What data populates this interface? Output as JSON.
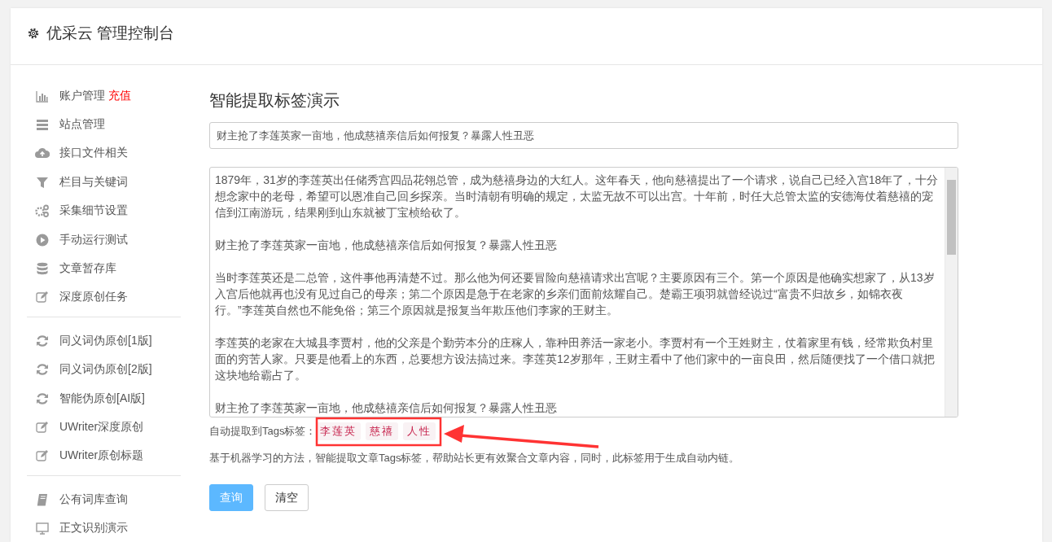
{
  "header": {
    "title": "优采云 管理控制台"
  },
  "sidebar": {
    "groups": [
      [
        {
          "label": "账户管理",
          "badge": "充值"
        },
        {
          "label": "站点管理"
        },
        {
          "label": "接口文件相关"
        },
        {
          "label": "栏目与关键词"
        },
        {
          "label": "采集细节设置"
        },
        {
          "label": "手动运行测试"
        },
        {
          "label": "文章暂存库"
        },
        {
          "label": "深度原创任务"
        }
      ],
      [
        {
          "label": "同义词伪原创[1版]"
        },
        {
          "label": "同义词伪原创[2版]"
        },
        {
          "label": "智能伪原创[AI版]"
        },
        {
          "label": "UWriter深度原创"
        },
        {
          "label": "UWriter原创标题"
        }
      ],
      [
        {
          "label": "公有词库查询"
        },
        {
          "label": "正文识别演示"
        }
      ]
    ]
  },
  "main": {
    "title": "智能提取标签演示",
    "title_field": {
      "value": "财主抢了李莲英家一亩地，他成慈禧亲信后如何报复？暴露人性丑恶"
    },
    "article": [
      "1879年，31岁的李莲英出任储秀宫四品花翎总管，成为慈禧身边的大红人。这年春天，他向慈禧提出了一个请求，说自己已经入宫18年了，十分想念家中的老母，希望可以恩准自己回乡探亲。当时清朝有明确的规定，太监无故不可以出宫。十年前，时任大总管太监的安德海仗着慈禧的宠信到江南游玩，结果刚到山东就被丁宝桢给砍了。",
      "财主抢了李莲英家一亩地，他成慈禧亲信后如何报复？暴露人性丑恶",
      "当时李莲英还是二总管，这件事他再清楚不过。那么他为何还要冒险向慈禧请求出宫呢？主要原因有三个。第一个原因是他确实想家了，从13岁入宫后他就再也没有见过自己的母亲；第二个原因是急于在老家的乡亲们面前炫耀自己。楚霸王项羽就曾经说过“富贵不归故乡，如锦衣夜行。”李莲英自然也不能免俗；第三个原因就是报复当年欺压他们李家的王财主。",
      "李莲英的老家在大城县李贾村，他的父亲是个勤劳本分的庄稼人，靠种田养活一家老小。李贾村有一个王姓财主，仗着家里有钱，经常欺负村里面的穷苦人家。只要是他看上的东西，总要想方设法搞过来。李莲英12岁那年，王财主看中了他们家中的一亩良田，然后随便找了一个借口就把这块地给霸占了。",
      "财主抢了李莲英家一亩地，他成慈禧亲信后如何报复？暴露人性丑恶"
    ],
    "tags_label": "自动提取到Tags标签：",
    "tags": [
      "李莲英",
      "慈禧",
      "人性"
    ],
    "description": "基于机器学习的方法，智能提取文章Tags标签，帮助站长更有效聚合文章内容，同时，此标签用于生成自动内链。",
    "buttons": [
      {
        "label": "查询",
        "kind": "primary"
      },
      {
        "label": "清空",
        "kind": "default"
      }
    ]
  }
}
